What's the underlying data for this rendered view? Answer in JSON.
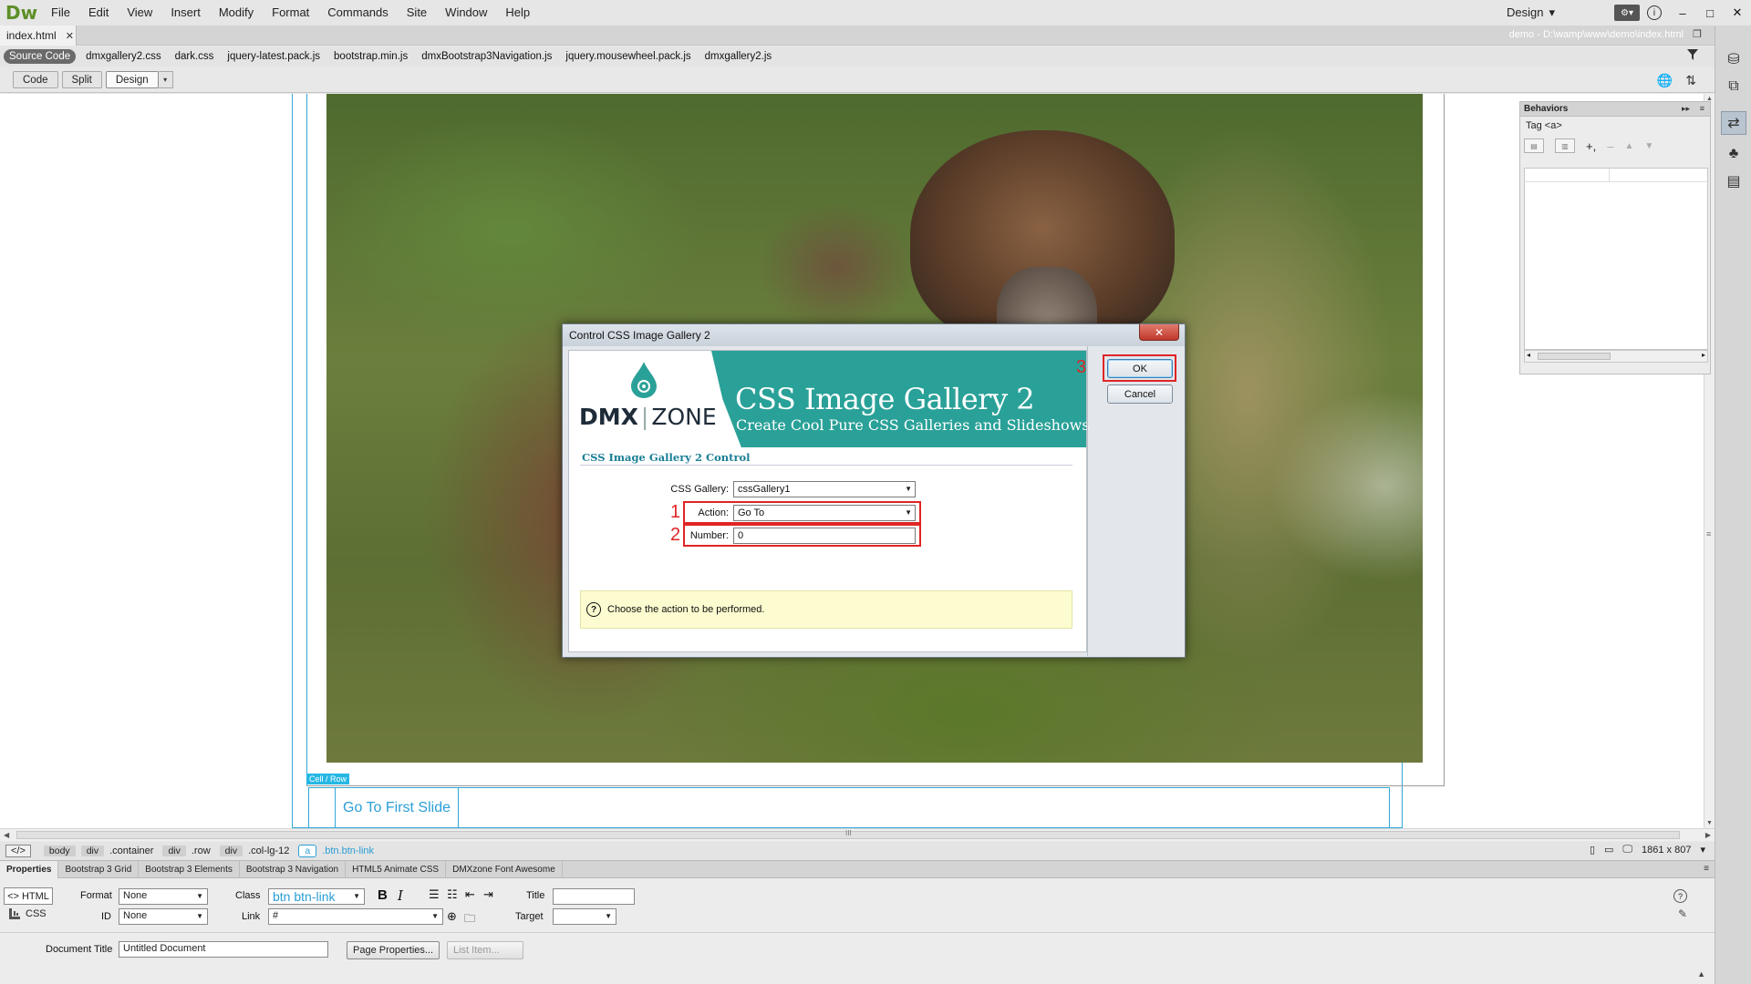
{
  "app": {
    "logo": "Dw",
    "menu": [
      "File",
      "Edit",
      "View",
      "Insert",
      "Modify",
      "Format",
      "Commands",
      "Site",
      "Window",
      "Help"
    ],
    "workspace": "Design",
    "workspace_arrow": "▾",
    "tool_chip": "⚙▾",
    "info_glyph": "i",
    "window_controls": [
      "–",
      "□",
      "✕"
    ]
  },
  "document": {
    "tab_name": "index.html",
    "tab_close": "✕",
    "path": "demo - D:\\wamp\\www\\demo\\index.html",
    "restore_glyph": "❐"
  },
  "related_files": [
    "Source Code",
    "dmxgallery2.css",
    "dark.css",
    "jquery-latest.pack.js",
    "bootstrap.min.js",
    "dmxBootstrap3Navigation.js",
    "jquery.mousewheel.pack.js",
    "dmxgallery2.js"
  ],
  "view_toolbar": {
    "code": "Code",
    "split": "Split",
    "design": "Design",
    "arrow": "▾",
    "globe": "🌐",
    "sort": "⇅"
  },
  "canvas": {
    "cell_label": "Cell / Row",
    "link_text": "Go To First Slide"
  },
  "dialog": {
    "title": "Control CSS Image Gallery 2",
    "close": "✕",
    "brand_dmx": "DMX",
    "brand_sep": "|",
    "brand_zone": "ZONE",
    "brand_title": "CSS Image Gallery 2",
    "brand_tagline": "Create Cool Pure CSS Galleries and Slideshows",
    "section_heading": "CSS Image Gallery 2 Control",
    "fields": {
      "gallery_label": "CSS Gallery:",
      "gallery_value": "cssGallery1",
      "action_label": "Action:",
      "action_value": "Go To",
      "number_label": "Number:",
      "number_value": "0"
    },
    "help_icon": "?",
    "help_text": "Choose the action to be performed.",
    "ok": "OK",
    "cancel": "Cancel",
    "annotations": [
      "1",
      "2",
      "3"
    ],
    "dd_arrow": "▼"
  },
  "behaviors": {
    "title": "Behaviors",
    "expand": "▸▸",
    "menu": "≡",
    "tag": "Tag <a>",
    "toolbar": [
      "+,",
      "–",
      "▲",
      "▼"
    ],
    "show_set": "▤",
    "show_all": "▥",
    "scroll_left": "◂",
    "scroll_right": "▸"
  },
  "icon_strip": [
    "⛁",
    "⧉",
    "⇄",
    "♣",
    "▤"
  ],
  "scrollbars": {
    "up": "▲",
    "down": "▼",
    "left": "◀",
    "right": "▶",
    "grip": "≡",
    "hgrip": "III"
  },
  "tag_selector": {
    "code_btn": "</>",
    "items": [
      {
        "tag": "body",
        "cls": ""
      },
      {
        "tag": "div",
        "cls": ".container"
      },
      {
        "tag": "div",
        "cls": ".row"
      },
      {
        "tag": "div",
        "cls": ".col-lg-12"
      },
      {
        "tag": "a",
        "cls": ".btn.btn-link"
      }
    ],
    "size": "1861 x 807",
    "size_arrow": "▾",
    "device_icons": [
      "▯",
      "▭",
      "🖵"
    ]
  },
  "properties": {
    "tabs": [
      "Properties",
      "Bootstrap 3 Grid",
      "Bootstrap 3 Elements",
      "Bootstrap 3 Navigation",
      "HTML5 Animate CSS",
      "DMXzone Font Awesome"
    ],
    "tabs_menu": "≡",
    "html_btn": "HTML",
    "css_btn": "CSS",
    "format_label": "Format",
    "format_value": "None",
    "class_label": "Class",
    "class_value": "btn btn-link",
    "id_label": "ID",
    "id_value": "None",
    "link_label": "Link",
    "link_value": "#",
    "title_label": "Title",
    "title_value": "",
    "target_label": "Target",
    "target_value": "",
    "doc_title_label": "Document Title",
    "doc_title_value": "Untitled Document",
    "page_props_btn": "Page Properties...",
    "list_item_btn": "List Item...",
    "bold": "B",
    "italic": "I",
    "list_icons": [
      "☰",
      "☷",
      "⇤",
      "⇥"
    ],
    "help": "?",
    "edit": "✎",
    "collapse": "▲",
    "point_to_file": "⊕",
    "browse": "🗀",
    "dd_arrow": "▼"
  },
  "colors": {
    "accent_teal": "#2aa198",
    "annotation_red": "#e02424",
    "link_blue": "#2a9fd6",
    "guide_blue": "#32a7d8"
  }
}
